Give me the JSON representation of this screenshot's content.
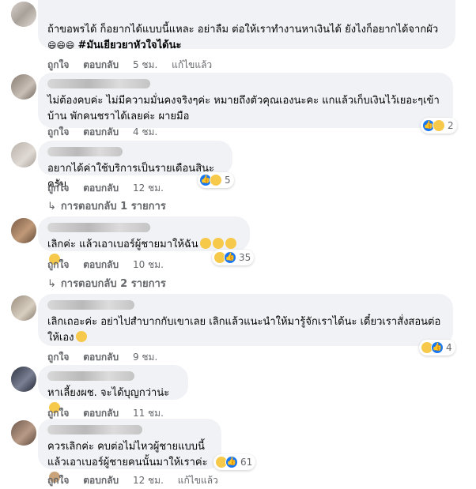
{
  "actions": {
    "like": "ถูกใจ",
    "reply": "ตอบกลับ",
    "edited": "แก้ไขแล้ว"
  },
  "comments": [
    {
      "text": "ถ้าขอพรได้ ก็อยากได้แบบนี้แหละ อย่าลืม ต่อให้เราทำงานหาเงินได้ ยังไงก็อยากได้จากผัว",
      "text2_emojis": "😄😄😄",
      "text2_bold": "#มันเยียวยาหัวใจได้นะ",
      "time": "5 ชม."
    },
    {
      "text": "ไม่ต้องคบค่ะ ไม่มีความมั่นคงจริงๆค่ะ หมายถึงตัวคุณเองนะคะ แกแล้วเก็บเงินไว้เยอะๆเข้าบ้าน พักคนชราได้เลยค่ะ ผายมือ",
      "time": "4 ชม.",
      "react_count": "2"
    },
    {
      "text": "อยากได้ค่าใช้บริการเป็นรายเดือนสินะครับ",
      "time": "12 ชม.",
      "react_count": "5",
      "replies": "การตอบกลับ 1 รายการ"
    },
    {
      "text": "เลิกค่ะ แล้วเอาเบอร์ผู้ชายมาให้ฉัน",
      "time": "10 ชม.",
      "react_count": "35",
      "replies": "การตอบกลับ 2 รายการ"
    },
    {
      "text": "เลิกเถอะค่ะ อย่าไปสำบากกับเขาเลย เลิกแล้วแนะนำให้มารู้จักเราได้นะ เดี๋ยวเราสั่งสอนต่อให้เอง",
      "time": "9 ชม.",
      "react_count": "4"
    },
    {
      "text": "หาเลี้ยงผช. จะได้บุญกว่าน่ะ",
      "time": "11 ชม."
    },
    {
      "text": "ควรเลิกค่ะ คบต่อไม่ไหวผู้ชายแบบนี้ แล้วเอาเบอร์ผู้ชายคนนั้นมาให้เราค่ะ",
      "time": "12 ชม.",
      "react_count": "61"
    }
  ],
  "colors": {
    "bubble": "#f0f2f5",
    "meta_text": "#65676b",
    "like_blue": "#1877f2",
    "haha_yellow": "#f7c94b"
  }
}
